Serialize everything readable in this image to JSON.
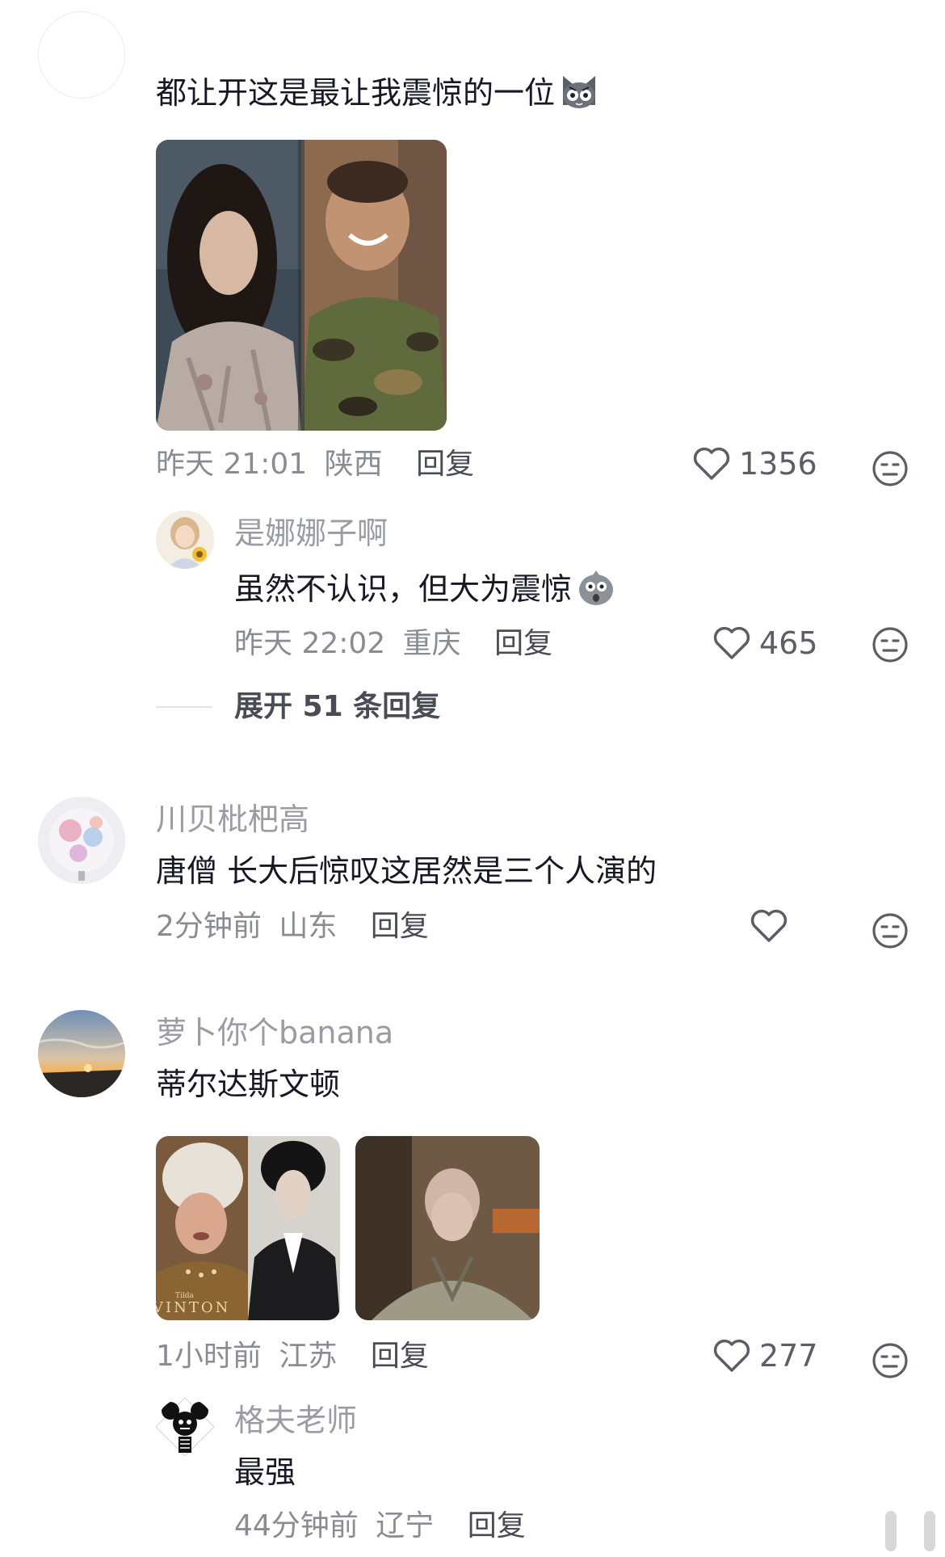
{
  "comments": [
    {
      "username": "",
      "text": "都让开这是最让我震惊的一位",
      "time": "昨天 21:01",
      "location": "陕西",
      "reply_label": "回复",
      "likes": "1356",
      "reply": {
        "username": "是娜娜子啊",
        "text": "虽然不认识，但大为震惊",
        "time": "昨天 22:02",
        "location": "重庆",
        "reply_label": "回复",
        "likes": "465"
      },
      "expand_label": "展开 51 条回复"
    },
    {
      "username": "川贝枇杷高",
      "text": "唐僧 长大后惊叹这居然是三个人演的",
      "time": "2分钟前",
      "location": "山东",
      "reply_label": "回复",
      "likes": ""
    },
    {
      "username": "萝卜你个banana",
      "text": "蒂尔达斯文顿",
      "time": "1小时前",
      "location": "江苏",
      "reply_label": "回复",
      "likes": "277",
      "image_caption": "VINTON",
      "image_caption_small": "Tilda",
      "reply": {
        "username": "格夫老师",
        "text": "最强",
        "time": "44分钟前",
        "location": "辽宁",
        "reply_label": "回复"
      }
    }
  ],
  "colors": {
    "text": "#161823",
    "muted": "#8a8c93",
    "username": "#9a9ca3",
    "action": "#4a4c55"
  },
  "icons": [
    "heart-outline-icon",
    "dislike-face-icon",
    "cat-emoji-icon",
    "shocked-emoji-icon"
  ]
}
